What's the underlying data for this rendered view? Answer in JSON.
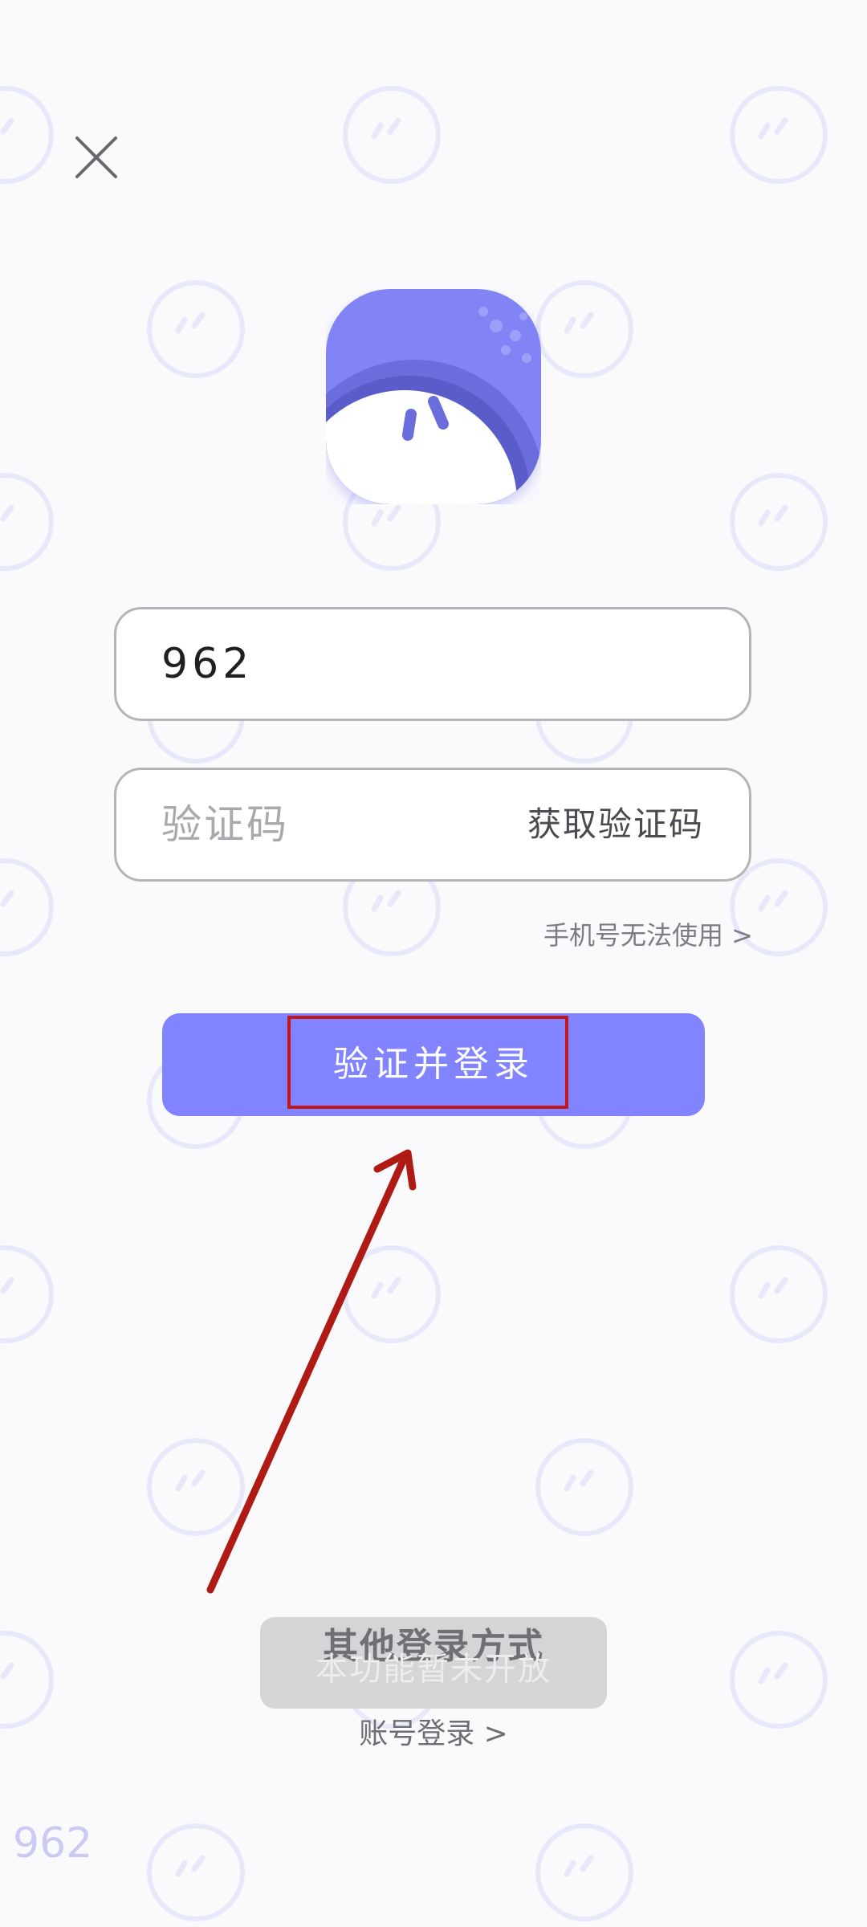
{
  "header": {
    "close_icon": "close-icon"
  },
  "logo": {
    "icon": "app-logo-icon",
    "accent_color": "#7b7cf2"
  },
  "form": {
    "phone_value": "962",
    "code_placeholder": "验证码",
    "get_code_label": "获取验证码",
    "phone_unavailable_label": "手机号无法使用 >"
  },
  "actions": {
    "login_label": "验证并登录",
    "login_color": "#8183ff"
  },
  "other_login": {
    "title": "其他登录方式",
    "toast": "本功能暂未开放",
    "account_login_label": "账号登录 >"
  },
  "watermark": {
    "text": "962"
  },
  "annotation": {
    "highlight_color": "#c2161d"
  }
}
